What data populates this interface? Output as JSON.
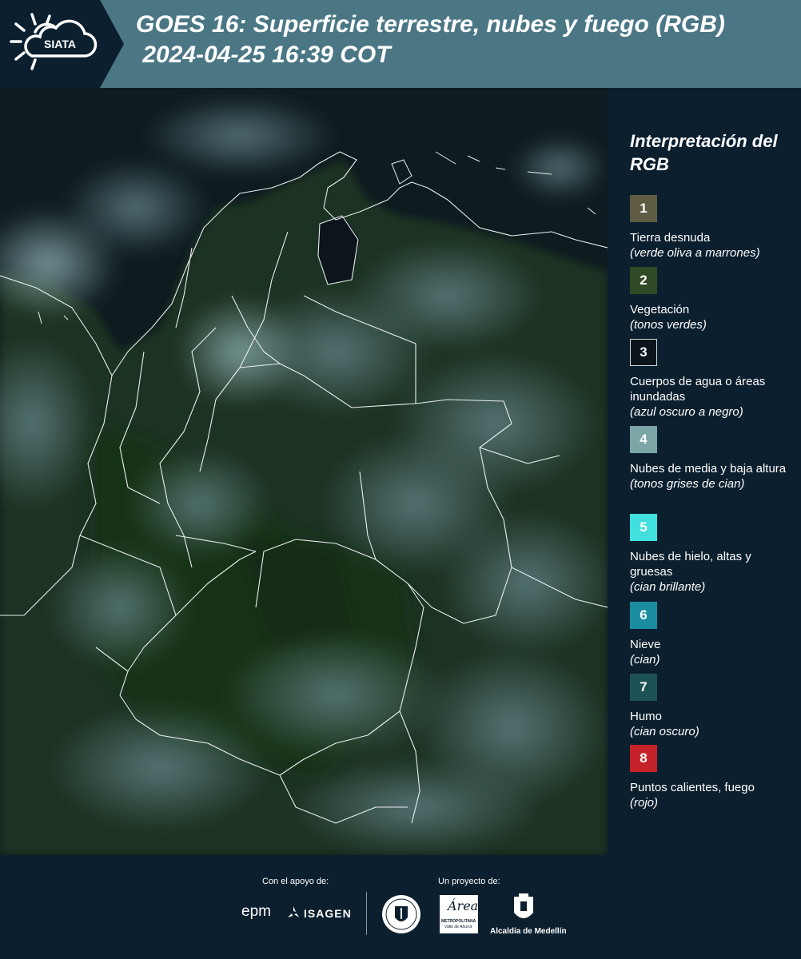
{
  "header": {
    "logo_text": "SIATA",
    "title": "GOES 16: Superficie terrestre, nubes y fuego (RGB)\n 2024-04-25 16:39 COT"
  },
  "legend": {
    "title": "Interpretación del RGB",
    "items": [
      {
        "num": "1",
        "label": "Tierra desnuda",
        "sub": "(verde oliva a marrones)",
        "color": "#5e5d44"
      },
      {
        "num": "2",
        "label": "Vegetación",
        "sub": "(tonos verdes)",
        "color": "#2f4a25"
      },
      {
        "num": "3",
        "label": "Cuerpos de agua o áreas inundadas",
        "sub": "(azul oscuro a negro)",
        "color": "#0b141a"
      },
      {
        "num": "4",
        "label": "Nubes de media y baja altura",
        "sub": "(tonos grises de cian)",
        "color": "#7ca6a6"
      },
      {
        "num": "5",
        "label": "Nubes de hielo, altas y gruesas",
        "sub": "(cian brillante)",
        "color": "#3fe0de"
      },
      {
        "num": "6",
        "label": "Nieve",
        "sub": "(cian)",
        "color": "#1a8ea0"
      },
      {
        "num": "7",
        "label": "Humo",
        "sub": "(cian oscuro)",
        "color": "#1d5356"
      },
      {
        "num": "8",
        "label": "Puntos calientes, fuego",
        "sub": "(rojo)",
        "color": "#c6222a"
      }
    ]
  },
  "footer": {
    "support_label": "Con el apoyo de:",
    "project_label": "Un proyecto de:",
    "epm": "epm",
    "isagen": "ISAGEN",
    "area_name": "Área",
    "area_sub": "METROPOLITANA",
    "area_sub2": "Valle de Aburrá",
    "alcaldia": "Alcaldía de Medellín"
  }
}
